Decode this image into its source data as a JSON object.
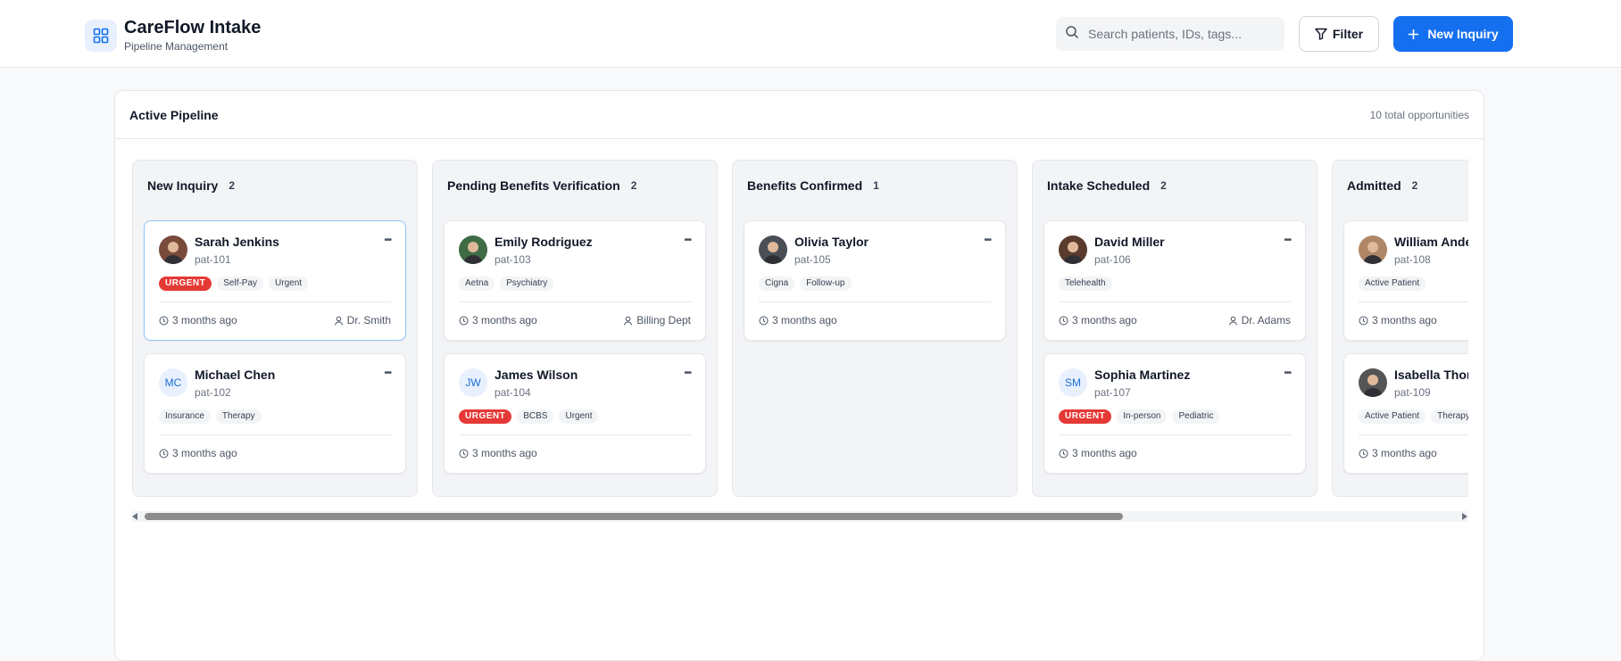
{
  "header": {
    "title": "CareFlow Intake",
    "subtitle": "Pipeline Management",
    "search_placeholder": "Search patients, IDs, tags...",
    "filter_label": "Filter",
    "new_label": "New Inquiry",
    "accent_color": "#1570ef"
  },
  "panel": {
    "title": "Active Pipeline",
    "count_text": "10 total opportunities"
  },
  "columns": [
    {
      "name": "New Inquiry",
      "count": "2",
      "cards": [
        {
          "name": "Sarah Jenkins",
          "id": "pat-101",
          "avatar": "photo",
          "tags": [
            "URGENT",
            "Self-Pay",
            "Urgent"
          ],
          "time": "3 months ago",
          "assignee": "Dr. Smith",
          "selected": true
        },
        {
          "name": "Michael Chen",
          "id": "pat-102",
          "avatar": "MC",
          "tags": [
            "Insurance",
            "Therapy"
          ],
          "time": "3 months ago",
          "assignee": ""
        }
      ]
    },
    {
      "name": "Pending Benefits Verification",
      "count": "2",
      "cards": [
        {
          "name": "Emily Rodriguez",
          "id": "pat-103",
          "avatar": "photo",
          "tags": [
            "Aetna",
            "Psychiatry"
          ],
          "time": "3 months ago",
          "assignee": "Billing Dept"
        },
        {
          "name": "James Wilson",
          "id": "pat-104",
          "avatar": "JW",
          "tags": [
            "URGENT",
            "BCBS",
            "Urgent"
          ],
          "time": "3 months ago",
          "assignee": ""
        }
      ]
    },
    {
      "name": "Benefits Confirmed",
      "count": "1",
      "cards": [
        {
          "name": "Olivia Taylor",
          "id": "pat-105",
          "avatar": "photo",
          "tags": [
            "Cigna",
            "Follow-up"
          ],
          "time": "3 months ago",
          "assignee": ""
        }
      ]
    },
    {
      "name": "Intake Scheduled",
      "count": "2",
      "cards": [
        {
          "name": "David Miller",
          "id": "pat-106",
          "avatar": "photo",
          "tags": [
            "Telehealth"
          ],
          "time": "3 months ago",
          "assignee": "Dr. Adams"
        },
        {
          "name": "Sophia Martinez",
          "id": "pat-107",
          "avatar": "SM",
          "tags": [
            "URGENT",
            "In-person",
            "Pediatric"
          ],
          "time": "3 months ago",
          "assignee": ""
        }
      ]
    },
    {
      "name": "Admitted",
      "count": "2",
      "cards": [
        {
          "name": "William Anderson",
          "id": "pat-108",
          "avatar": "photo",
          "tags": [
            "Active Patient"
          ],
          "time": "3 months ago",
          "assignee": ""
        },
        {
          "name": "Isabella Thomas",
          "id": "pat-109",
          "avatar": "photo",
          "tags": [
            "Active Patient",
            "Therapy"
          ],
          "time": "3 months ago",
          "assignee": ""
        }
      ]
    }
  ]
}
